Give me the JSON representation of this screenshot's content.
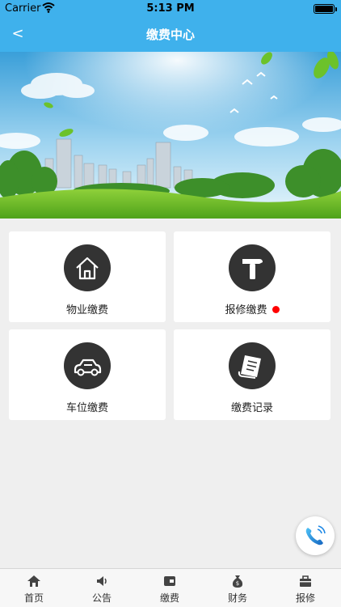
{
  "status_bar": {
    "carrier": "Carrier",
    "time": "5:13 PM"
  },
  "nav": {
    "back_label": "<",
    "title": "缴费中心"
  },
  "cards": [
    {
      "label": "物业缴费",
      "icon": "house-icon"
    },
    {
      "label": "报修缴费",
      "icon": "hammer-icon",
      "badge": "red-dot"
    },
    {
      "label": "车位缴费",
      "icon": "car-icon"
    },
    {
      "label": "缴费记录",
      "icon": "receipt-icon"
    }
  ],
  "floating": {
    "icon": "phone-icon"
  },
  "tabs": [
    {
      "label": "首页",
      "icon": "home-icon"
    },
    {
      "label": "公告",
      "icon": "speaker-icon"
    },
    {
      "label": "缴费",
      "icon": "wallet-icon"
    },
    {
      "label": "财务",
      "icon": "money-bag-icon"
    },
    {
      "label": "报修",
      "icon": "toolbox-icon"
    }
  ],
  "colors": {
    "header": "#3fb1ec",
    "badge": "#ff0000",
    "icon_circle": "#333333",
    "background": "#efefef"
  }
}
